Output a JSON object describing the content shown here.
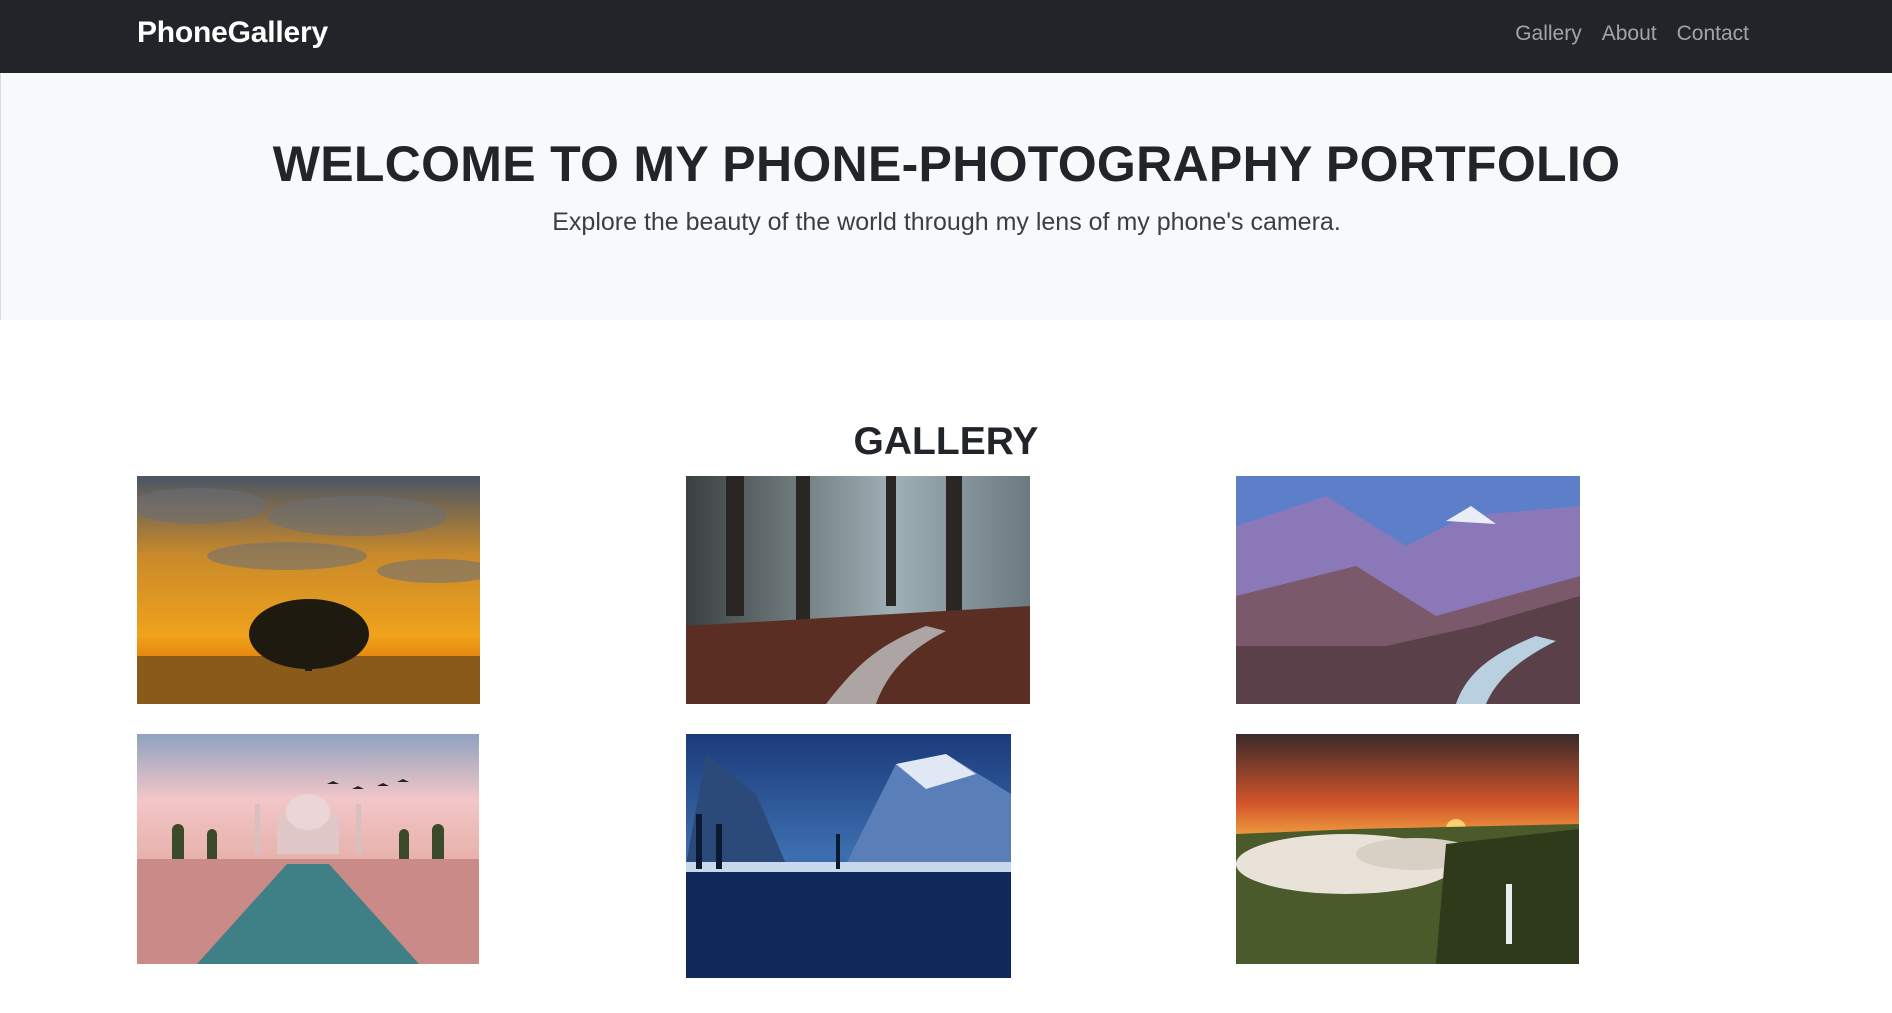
{
  "nav": {
    "brand": "PhoneGallery",
    "links": [
      "Gallery",
      "About",
      "Contact"
    ]
  },
  "hero": {
    "title": "WELCOME TO MY PHONE-PHOTOGRAPHY PORTFOLIO",
    "subtitle": "Explore the beauty of the world through my lens of my phone's camera."
  },
  "gallery": {
    "title": "GALLERY",
    "photos": [
      {
        "subject": "tree-at-sunset-photo"
      },
      {
        "subject": "misty-forest-stream-photo"
      },
      {
        "subject": "mountain-valley-river-photo"
      },
      {
        "subject": "taj-mahal-photo"
      },
      {
        "subject": "snowy-mountain-lake-photo"
      },
      {
        "subject": "waterfall-sunset-valley-photo"
      }
    ]
  },
  "colors": {
    "navbar_bg": "#212529",
    "hero_bg": "#f8f9fa",
    "text": "#212529"
  }
}
